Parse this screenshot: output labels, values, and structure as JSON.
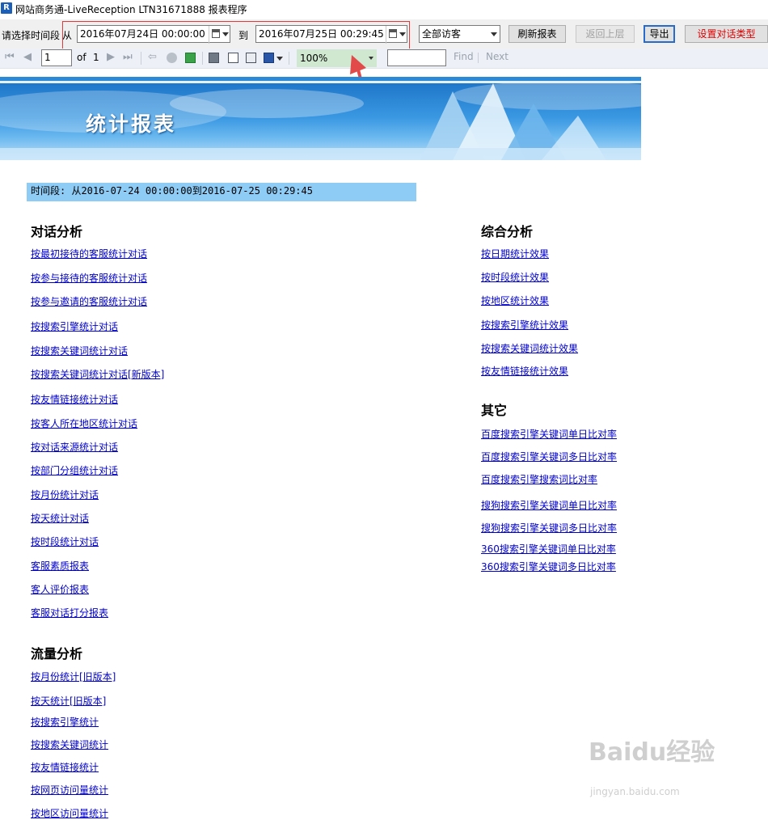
{
  "titlebar": {
    "icon_letter": "R",
    "title": "网站商务通-LiveReception LTN31671888  报表程序"
  },
  "filter": {
    "prompt_label": "请选择时间段",
    "from_label": "从",
    "from_value": "2016年07月24日 00:00:00",
    "to_label": "到",
    "to_value": "2016年07月25日 00:29:45",
    "visitor_select": "全部访客",
    "refresh_label": "刷新报表",
    "back_label": "返回上层",
    "export_label": "导出",
    "set_dialog_type_label": "设置对话类型"
  },
  "report_toolbar": {
    "page_value": "1",
    "of_label": "of",
    "total_pages": "1",
    "zoom_value": "100%",
    "find_label": "Find",
    "next_label": "Next",
    "find_value": ""
  },
  "banner": {
    "title": "统计报表"
  },
  "period_text": "时间段: 从2016-07-24 00:00:00到2016-07-25 00:29:45",
  "sections": {
    "dialog": {
      "title": "对话分析",
      "links": [
        "按最初接待的客服统计对话",
        "按参与接待的客服统计对话",
        "按参与邀请的客服统计对话",
        "按搜索引擎统计对话",
        "按搜索关键词统计对话",
        "按搜索关键词统计对话[新版本]",
        "按友情链接统计对话",
        "按客人所在地区统计对话",
        "按对话来源统计对话",
        "按部门分组统计对话",
        "按月份统计对话",
        "按天统计对话",
        "按时段统计对话",
        "客服素质报表",
        "客人评价报表",
        "客服对话打分报表"
      ]
    },
    "traffic": {
      "title": "流量分析",
      "links": [
        "按月份统计[旧版本]",
        "按天统计[旧版本]",
        "按搜索引擎统计",
        "按搜索关键词统计",
        "按友情链接统计",
        "按网页访问量统计",
        "按地区访问量统计"
      ]
    },
    "overall": {
      "title": "综合分析",
      "links": [
        "按日期统计效果",
        "按时段统计效果",
        "按地区统计效果",
        "按搜索引擎统计效果",
        "按搜索关键词统计效果",
        "按友情链接统计效果"
      ]
    },
    "other": {
      "title": "其它",
      "links": [
        "百度搜索引擎关键词单日比对率",
        "百度搜索引擎关键词多日比对率",
        "百度搜索引擎搜索词比对率",
        "搜狗搜索引擎关键词单日比对率",
        "搜狗搜索引擎关键词多日比对率",
        "360搜索引擎关键词单日比对率",
        "360搜索引擎关键词多日比对率"
      ]
    }
  },
  "watermark": {
    "brand": "Baidu经验",
    "url": "jingyan.baidu.com"
  },
  "colors": {
    "link": "#0000cc",
    "highlight": "#e03a3a",
    "period_bg": "#8ecbf5",
    "banner": "#2c89d6"
  }
}
